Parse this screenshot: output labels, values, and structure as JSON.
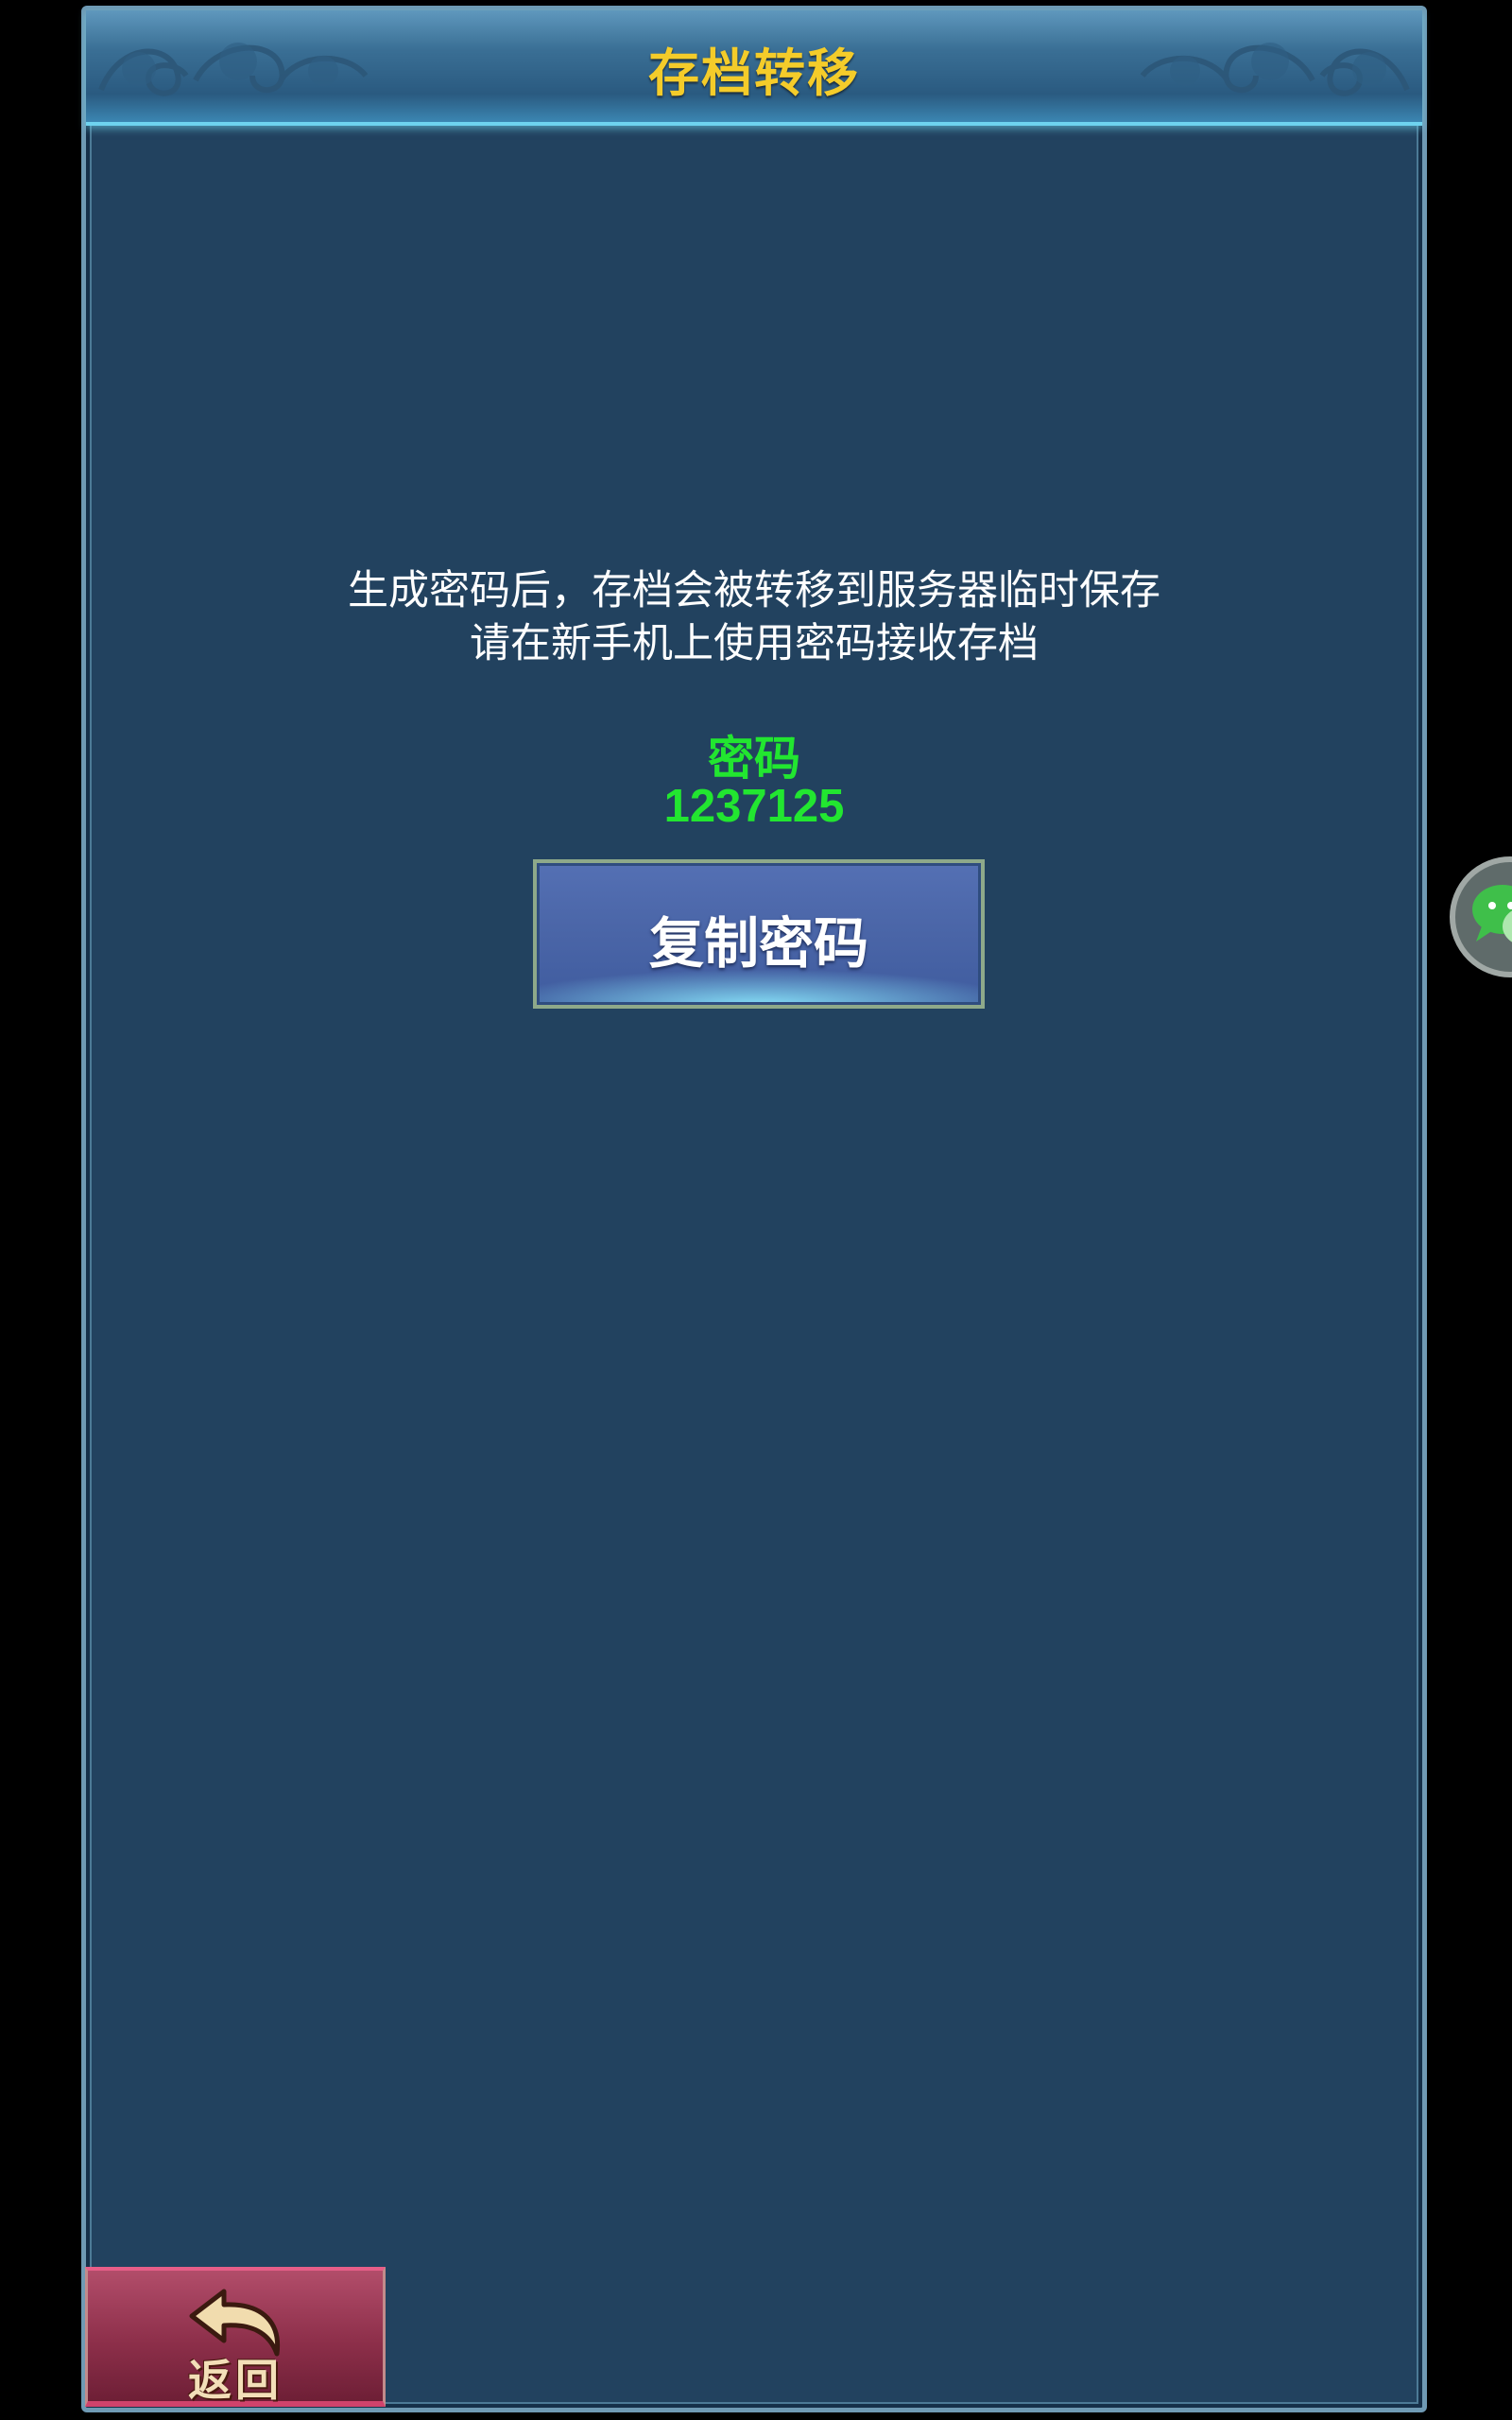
{
  "header": {
    "title": "存档转移"
  },
  "info": {
    "line1": "生成密码后，存档会被转移到服务器临时保存",
    "line2": "请在新手机上使用密码接收存档"
  },
  "password": {
    "label": "密码",
    "value": "1237125"
  },
  "copy_button": {
    "label": "复制密码"
  },
  "back_button": {
    "label": "返回",
    "icon": "back-arrow-icon"
  },
  "side_button": {
    "icon": "wechat-icon"
  },
  "colors": {
    "title": "#f4cc2a",
    "password": "#22e630",
    "panel": "#22425f",
    "button": "#4b66a8",
    "back_button": "#8d2f4a"
  }
}
